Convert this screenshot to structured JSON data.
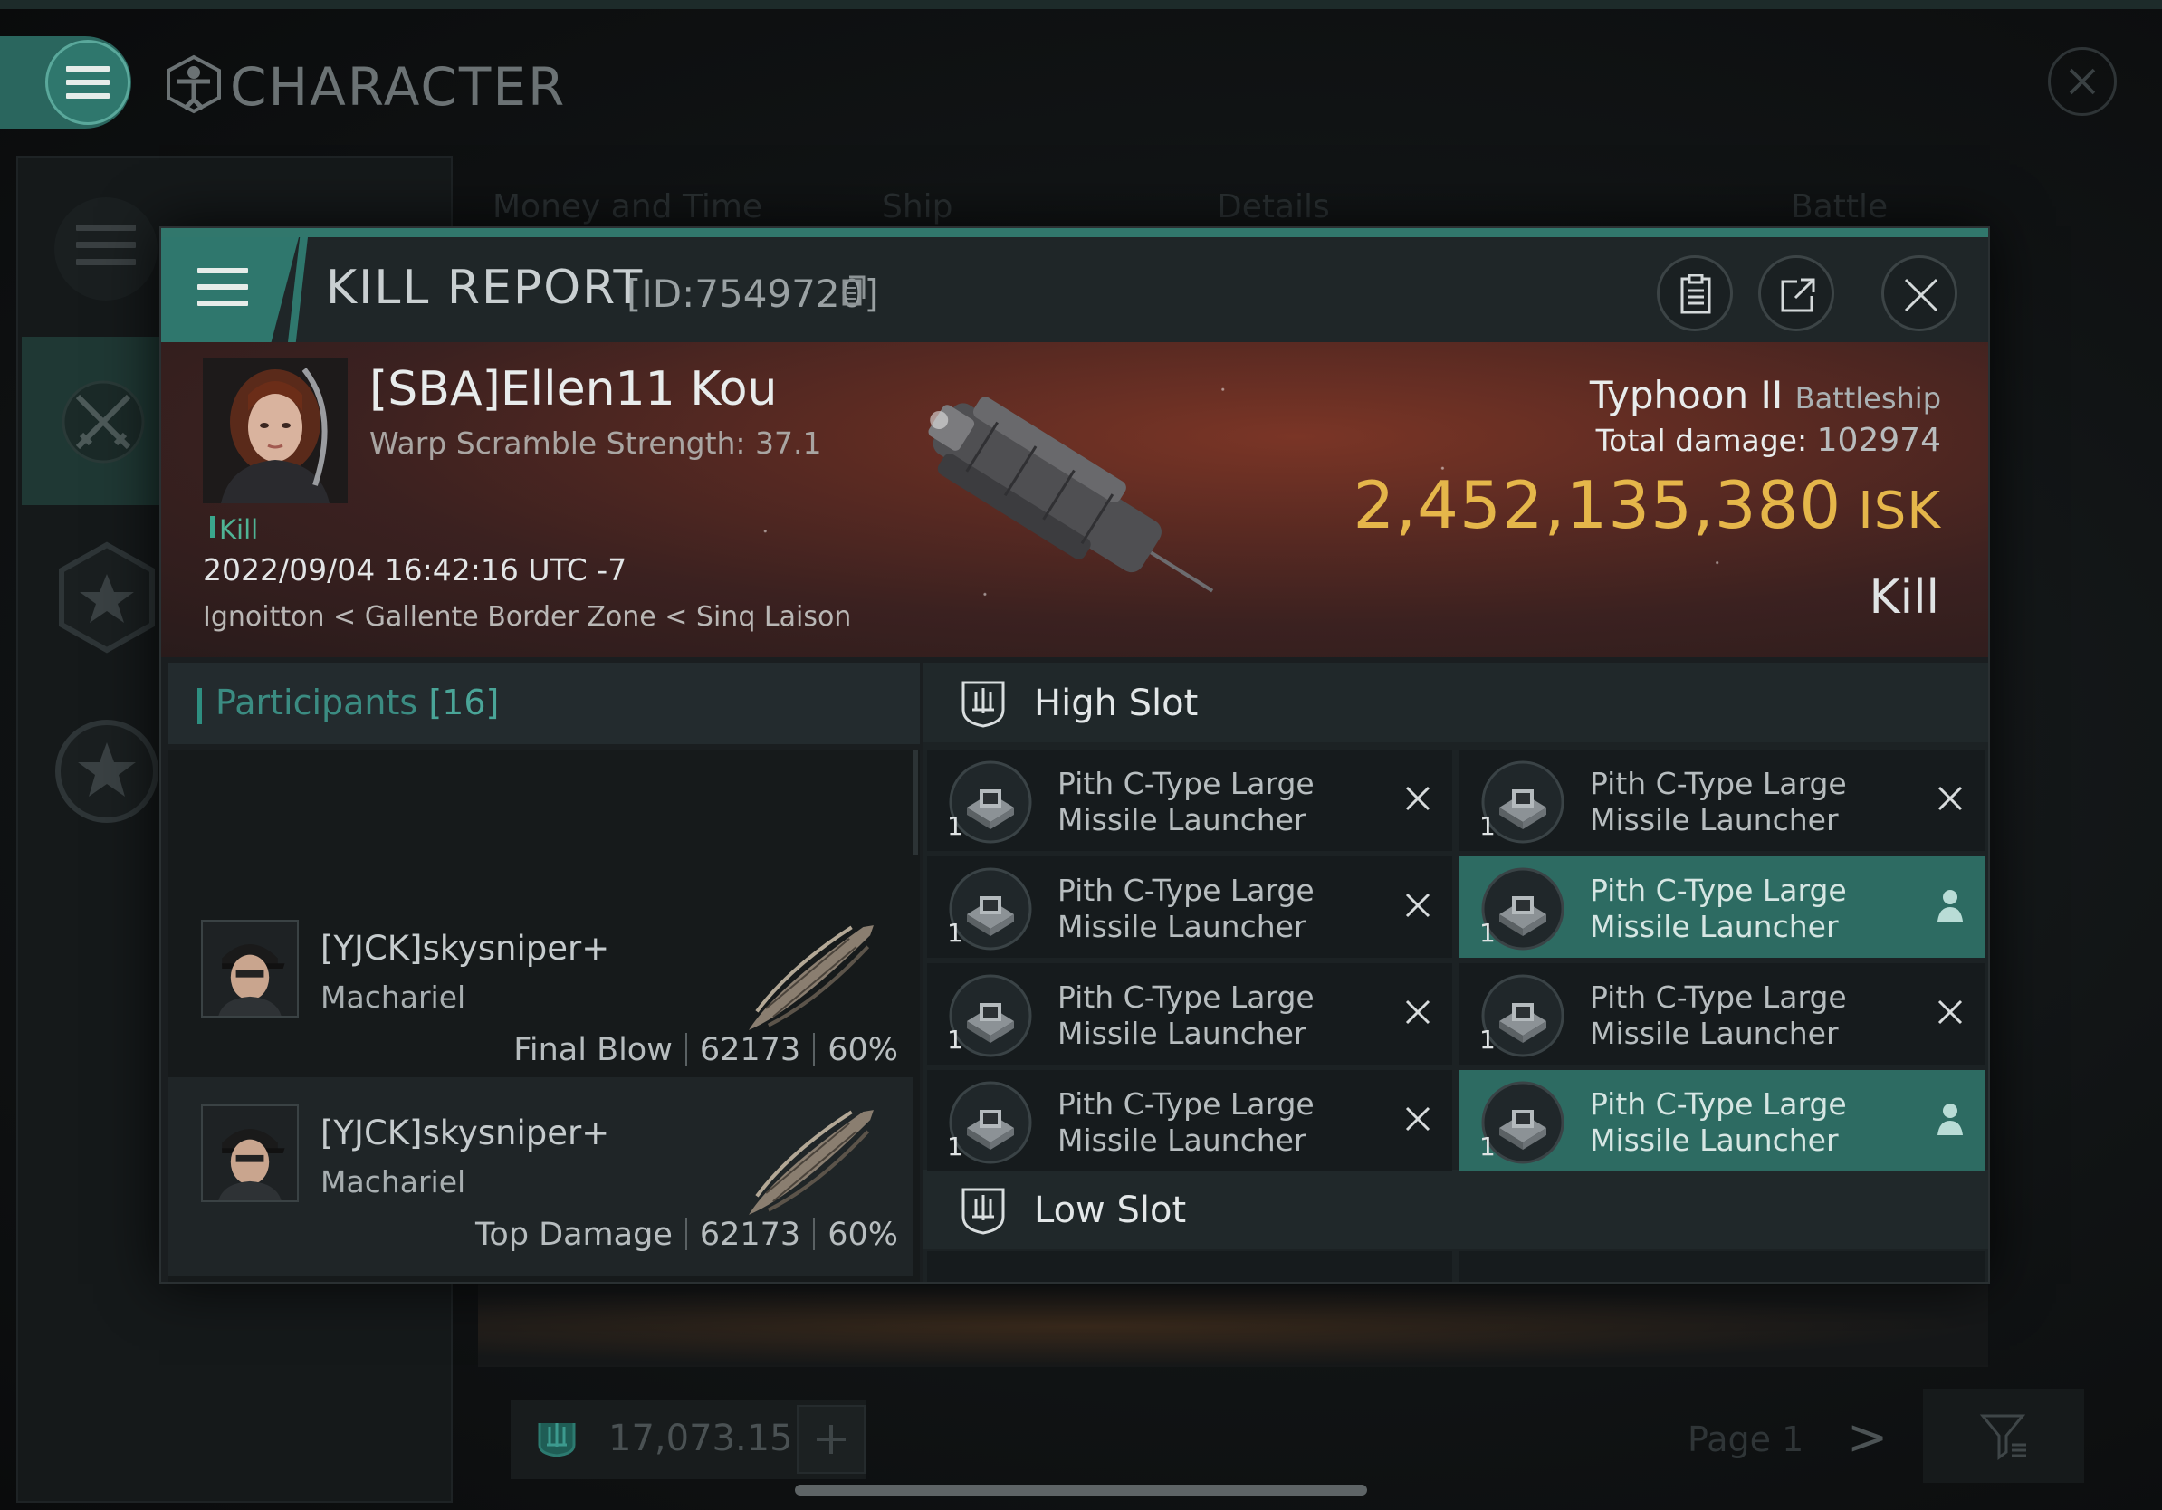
{
  "app": {
    "title": "CHARACTER"
  },
  "background": {
    "tabs": [
      "Money and Time",
      "Ship",
      "Details",
      "Battle Status"
    ],
    "wallet_value": "17,073.15",
    "page_label": "Page 1",
    "next_glyph": ">"
  },
  "kill_report": {
    "title": "KILL REPORT",
    "id_text": "[ID:7549720]",
    "victim": {
      "name": "[SBA]Ellen11 Kou",
      "warp_scramble": "Warp Scramble Strength: 37.1",
      "tag": "Kill",
      "datetime": "2022/09/04 16:42:16 UTC -7",
      "location": "Ignoitton < Gallente Border Zone < Sinq Laison",
      "ship_name": "Typhoon II",
      "ship_class": "Battleship",
      "total_damage_label": "Total damage:",
      "total_damage_value": "102974",
      "isk_value": "2,452,135,380",
      "isk_unit": "ISK",
      "result_label": "Kill"
    },
    "participants": {
      "title": "Participants",
      "count": "[16]",
      "rows": [
        {
          "name": "[YJCK]skysniper+",
          "ship": "Machariel",
          "role": "Final Blow",
          "damage": "62173",
          "percent": "60%"
        },
        {
          "name": "[YJCK]skysniper+",
          "ship": "Machariel",
          "role": "Top Damage",
          "damage": "62173",
          "percent": "60%"
        }
      ]
    },
    "fitting": {
      "high_slot_title": "High Slot",
      "low_slot_title": "Low Slot",
      "high_modules": [
        {
          "line1": "Pith C-Type Large",
          "line2": "Missile Launcher",
          "qty": "1",
          "state": "destroyed"
        },
        {
          "line1": "Pith C-Type Large",
          "line2": "Missile Launcher",
          "qty": "1",
          "state": "destroyed"
        },
        {
          "line1": "Pith C-Type Large",
          "line2": "Missile Launcher",
          "qty": "1",
          "state": "destroyed"
        },
        {
          "line1": "Pith C-Type Large",
          "line2": "Missile Launcher",
          "qty": "1",
          "state": "dropped"
        },
        {
          "line1": "Pith C-Type Large",
          "line2": "Missile Launcher",
          "qty": "1",
          "state": "destroyed"
        },
        {
          "line1": "Pith C-Type Large",
          "line2": "Missile Launcher",
          "qty": "1",
          "state": "destroyed"
        },
        {
          "line1": "Pith C-Type Large",
          "line2": "Missile Launcher",
          "qty": "1",
          "state": "destroyed"
        },
        {
          "line1": "Pith C-Type Large",
          "line2": "Missile Launcher",
          "qty": "1",
          "state": "dropped"
        }
      ]
    }
  },
  "colors": {
    "accent": "#2f776d",
    "isk_gold": "#e5b64a",
    "kill_green": "#4fb394",
    "banner_red": "#7a3526"
  },
  "icons": [
    "menu-icon",
    "character-icon",
    "close-icon",
    "copy-icon",
    "clipboard-icon",
    "share-icon",
    "shield-icon",
    "star-icon",
    "crossed-swords-icon",
    "launcher-icon",
    "x-icon",
    "person-icon",
    "wallet-icon",
    "plus-icon",
    "filter-icon"
  ]
}
